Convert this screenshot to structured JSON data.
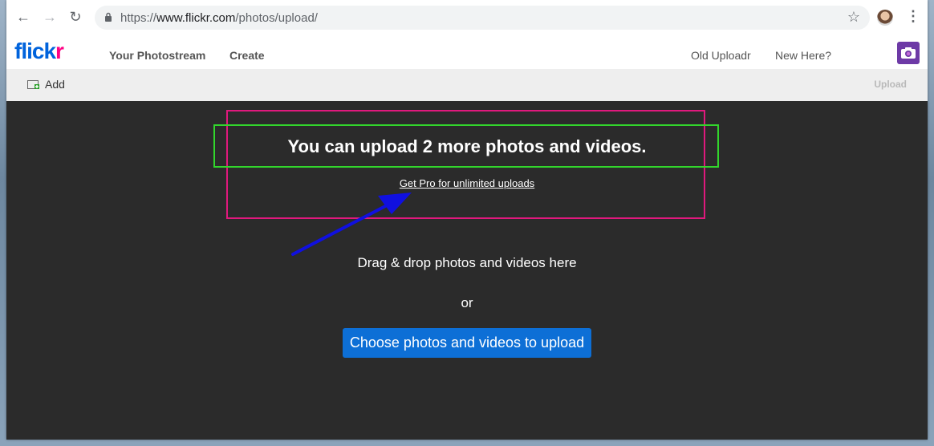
{
  "browser": {
    "url_prefix": "https://",
    "url_host": "www.flickr.com",
    "url_path": "/photos/upload/",
    "icons": [
      "back-arrow-icon",
      "forward-arrow-icon",
      "reload-icon",
      "lock-icon",
      "star-icon",
      "profile-avatar",
      "menu-dots-icon"
    ]
  },
  "header": {
    "logo_main": "flick",
    "logo_accent": "r",
    "nav": [
      "Your Photostream",
      "Create"
    ],
    "right_links": [
      "Old Uploadr",
      "New Here?"
    ]
  },
  "toolbar": {
    "add_label": "Add",
    "upload_label": "Upload"
  },
  "main": {
    "limit_message": "You can upload 2 more photos and videos.",
    "pro_link": "Get Pro for unlimited uploads",
    "drop_text": "Drag & drop photos and videos here",
    "or_text": "or",
    "choose_button": "Choose photos and videos to upload"
  },
  "colors": {
    "flickr_blue": "#0063dc",
    "flickr_pink": "#ff0084",
    "annotation_pink": "#e0197d",
    "annotation_green": "#32d62c",
    "annotation_arrow": "#1010e0",
    "button_blue": "#0d6fd6"
  }
}
